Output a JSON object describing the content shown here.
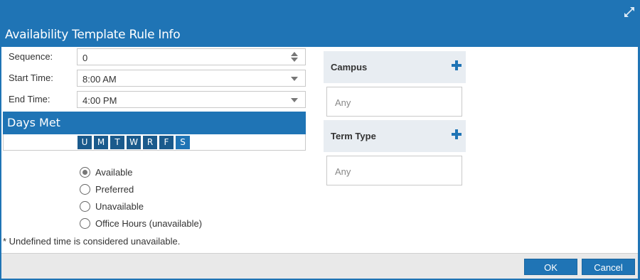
{
  "dialog": {
    "title": "Availability Template Rule Info"
  },
  "form": {
    "sequence_label": "Sequence:",
    "sequence_value": "0",
    "start_time_label": "Start Time:",
    "start_time_value": "8:00 AM",
    "end_time_label": "End Time:",
    "end_time_value": "4:00 PM"
  },
  "days_met": {
    "header": "Days Met",
    "days": [
      "U",
      "M",
      "T",
      "W",
      "R",
      "F",
      "S"
    ]
  },
  "availability": {
    "options": [
      "Available",
      "Preferred",
      "Unavailable",
      "Office Hours (unavailable)"
    ],
    "selected": "Available"
  },
  "footnote": "* Undefined time is considered unavailable.",
  "campus": {
    "label": "Campus",
    "value": "Any"
  },
  "term_type": {
    "label": "Term Type",
    "value": "Any"
  },
  "footer": {
    "ok_label": "OK",
    "cancel_label": "Cancel"
  },
  "colors": {
    "primary": "#1f74b5",
    "day_button": "#1a5a8c",
    "panel_header": "#e8edf2"
  },
  "icons": {
    "expand": "expand-icon",
    "add": "plus-icon",
    "spinner": "spinner-arrows-icon",
    "dropdown": "chevron-down-icon"
  }
}
